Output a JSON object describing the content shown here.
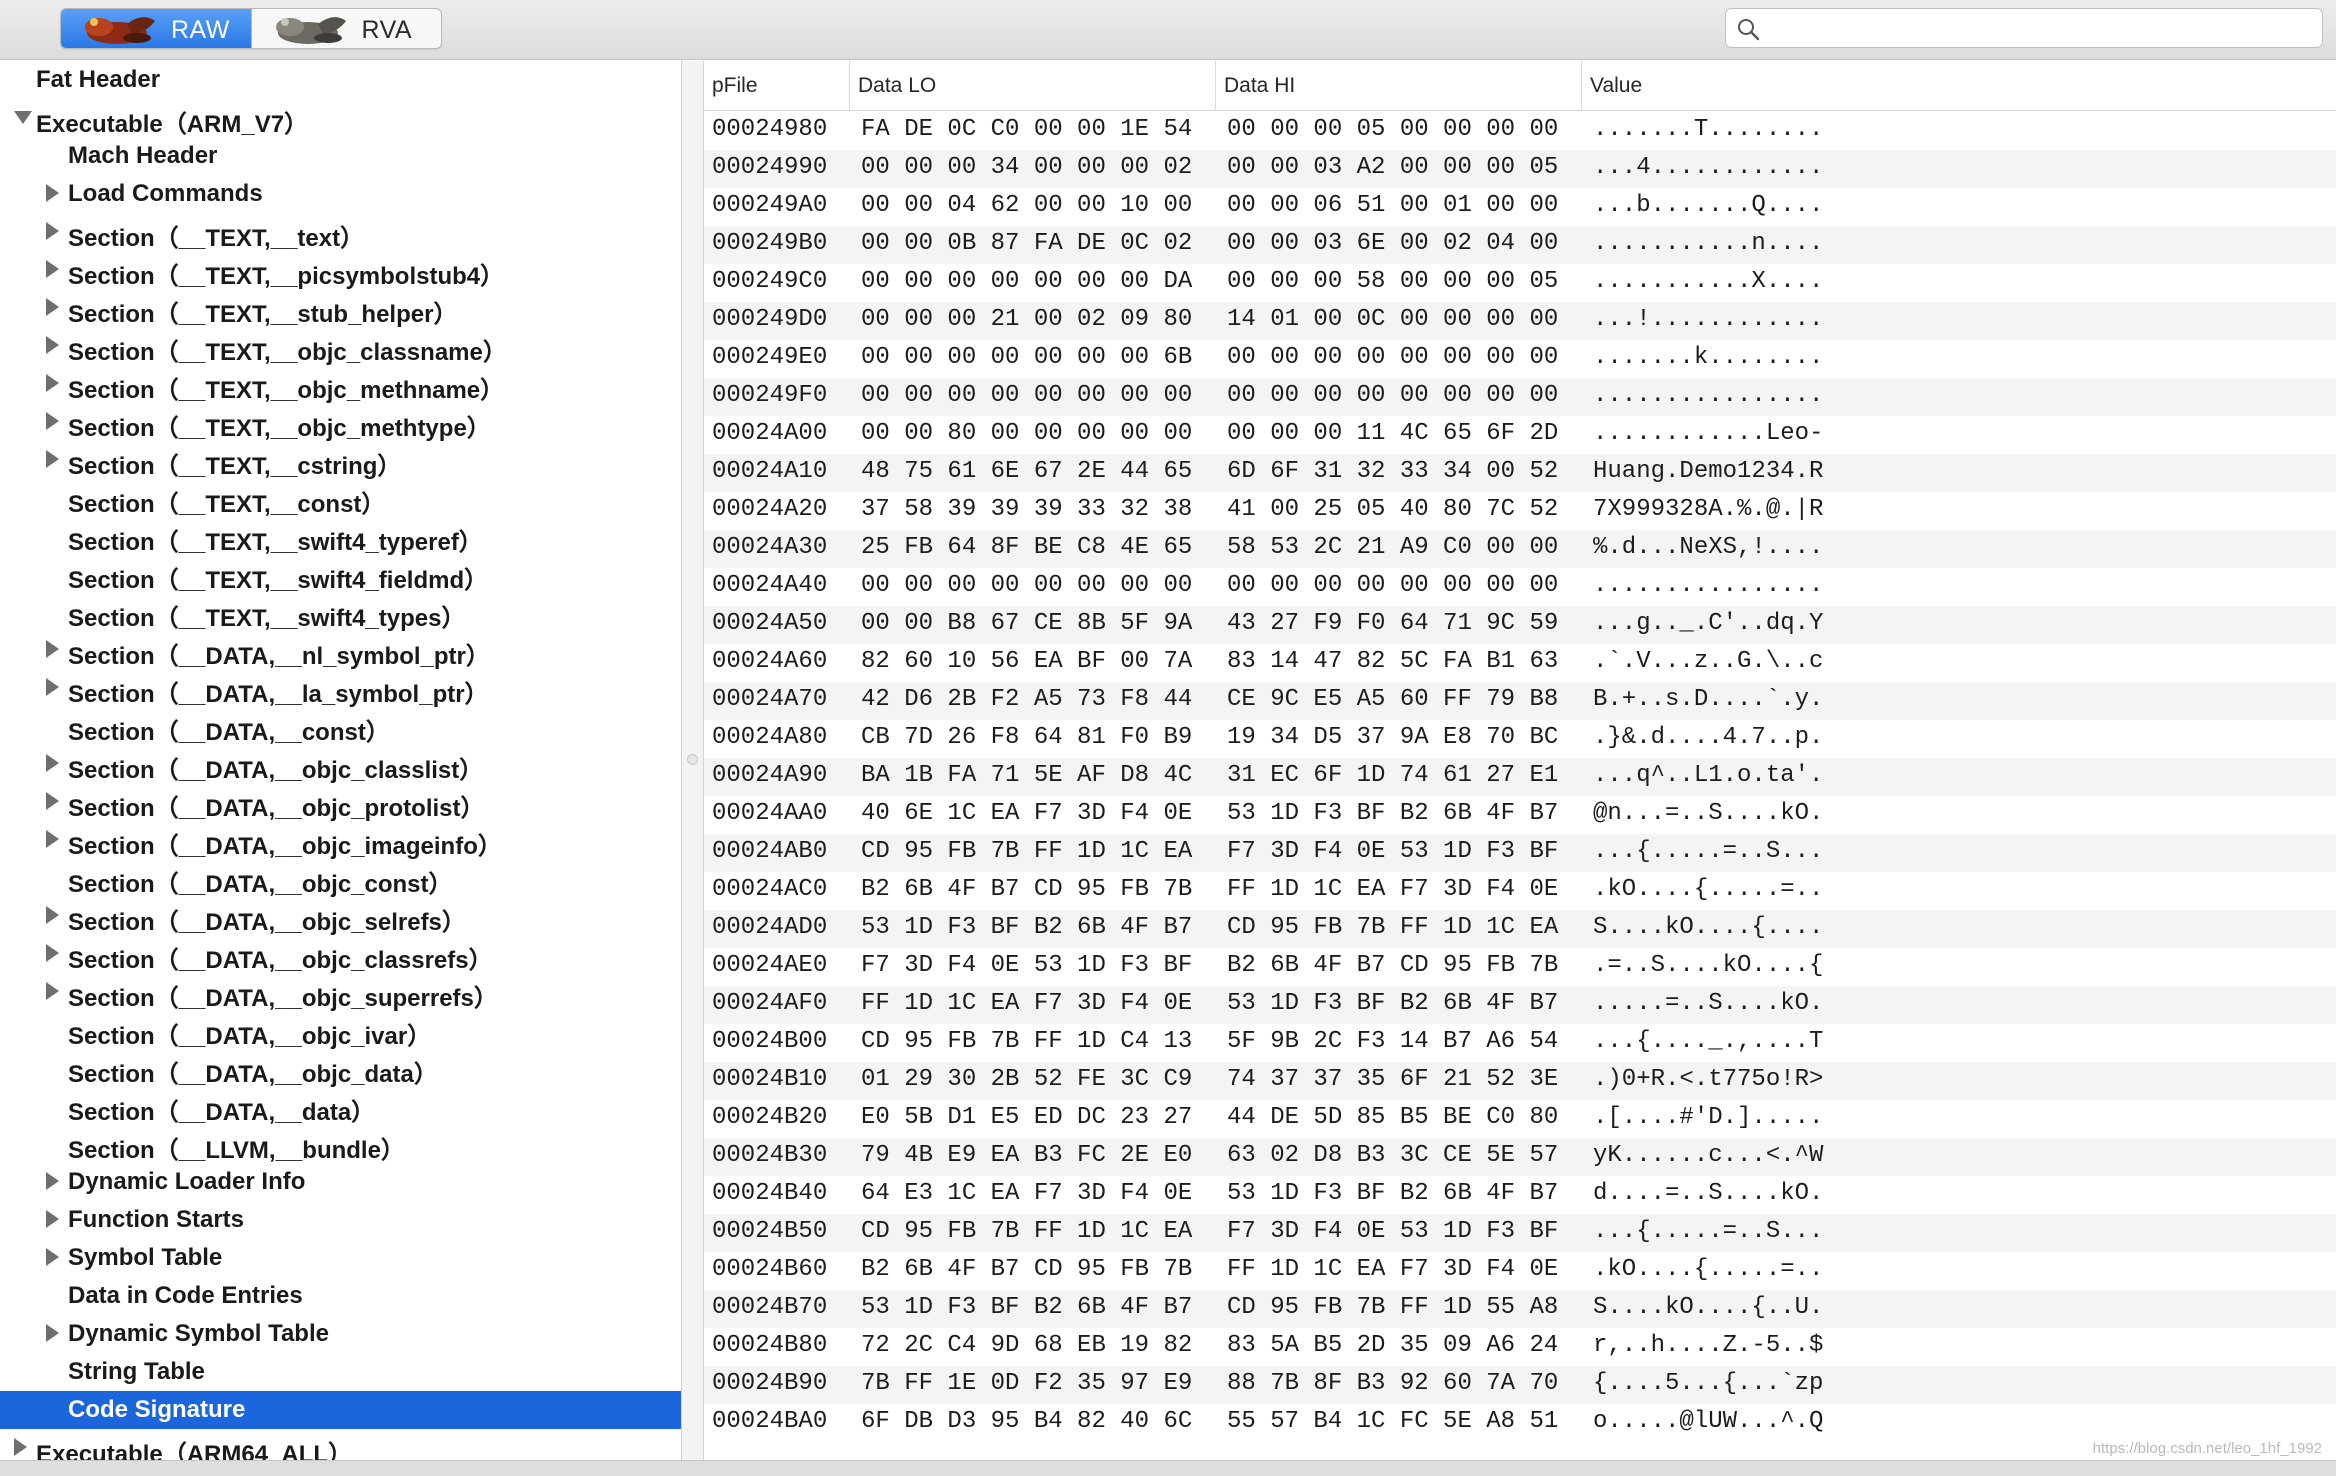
{
  "toolbar": {
    "segments": [
      {
        "label": "RAW",
        "icon": "red-frog-icon",
        "selected": true
      },
      {
        "label": "RVA",
        "icon": "grey-frog-icon",
        "selected": false
      }
    ],
    "search": {
      "placeholder": "",
      "value": ""
    }
  },
  "sidebar": {
    "items": [
      {
        "label": "Fat Header",
        "level": 0,
        "disclosure": "none",
        "selected": false
      },
      {
        "label": "Executable（ARM_V7）",
        "level": 0,
        "disclosure": "open",
        "selected": false
      },
      {
        "label": "Mach Header",
        "level": 1,
        "disclosure": "none",
        "selected": false
      },
      {
        "label": "Load Commands",
        "level": 1,
        "disclosure": "closed",
        "selected": false
      },
      {
        "label": "Section（__TEXT,__text）",
        "level": 1,
        "disclosure": "closed",
        "selected": false
      },
      {
        "label": "Section（__TEXT,__picsymbolstub4）",
        "level": 1,
        "disclosure": "closed",
        "selected": false
      },
      {
        "label": "Section（__TEXT,__stub_helper）",
        "level": 1,
        "disclosure": "closed",
        "selected": false
      },
      {
        "label": "Section（__TEXT,__objc_classname）",
        "level": 1,
        "disclosure": "closed",
        "selected": false
      },
      {
        "label": "Section（__TEXT,__objc_methname）",
        "level": 1,
        "disclosure": "closed",
        "selected": false
      },
      {
        "label": "Section（__TEXT,__objc_methtype）",
        "level": 1,
        "disclosure": "closed",
        "selected": false
      },
      {
        "label": "Section（__TEXT,__cstring）",
        "level": 1,
        "disclosure": "closed",
        "selected": false
      },
      {
        "label": "Section（__TEXT,__const）",
        "level": 1,
        "disclosure": "none",
        "selected": false
      },
      {
        "label": "Section（__TEXT,__swift4_typeref）",
        "level": 1,
        "disclosure": "none",
        "selected": false
      },
      {
        "label": "Section（__TEXT,__swift4_fieldmd）",
        "level": 1,
        "disclosure": "none",
        "selected": false
      },
      {
        "label": "Section（__TEXT,__swift4_types）",
        "level": 1,
        "disclosure": "none",
        "selected": false
      },
      {
        "label": "Section（__DATA,__nl_symbol_ptr）",
        "level": 1,
        "disclosure": "closed",
        "selected": false
      },
      {
        "label": "Section（__DATA,__la_symbol_ptr）",
        "level": 1,
        "disclosure": "closed",
        "selected": false
      },
      {
        "label": "Section（__DATA,__const）",
        "level": 1,
        "disclosure": "none",
        "selected": false
      },
      {
        "label": "Section（__DATA,__objc_classlist）",
        "level": 1,
        "disclosure": "closed",
        "selected": false
      },
      {
        "label": "Section（__DATA,__objc_protolist）",
        "level": 1,
        "disclosure": "closed",
        "selected": false
      },
      {
        "label": "Section（__DATA,__objc_imageinfo）",
        "level": 1,
        "disclosure": "closed",
        "selected": false
      },
      {
        "label": "Section（__DATA,__objc_const）",
        "level": 1,
        "disclosure": "none",
        "selected": false
      },
      {
        "label": "Section（__DATA,__objc_selrefs）",
        "level": 1,
        "disclosure": "closed",
        "selected": false
      },
      {
        "label": "Section（__DATA,__objc_classrefs）",
        "level": 1,
        "disclosure": "closed",
        "selected": false
      },
      {
        "label": "Section（__DATA,__objc_superrefs）",
        "level": 1,
        "disclosure": "closed",
        "selected": false
      },
      {
        "label": "Section（__DATA,__objc_ivar）",
        "level": 1,
        "disclosure": "none",
        "selected": false
      },
      {
        "label": "Section（__DATA,__objc_data）",
        "level": 1,
        "disclosure": "none",
        "selected": false
      },
      {
        "label": "Section（__DATA,__data）",
        "level": 1,
        "disclosure": "none",
        "selected": false
      },
      {
        "label": "Section（__LLVM,__bundle）",
        "level": 1,
        "disclosure": "none",
        "selected": false
      },
      {
        "label": "Dynamic Loader Info",
        "level": 1,
        "disclosure": "closed",
        "selected": false
      },
      {
        "label": "Function Starts",
        "level": 1,
        "disclosure": "closed",
        "selected": false
      },
      {
        "label": "Symbol Table",
        "level": 1,
        "disclosure": "closed",
        "selected": false
      },
      {
        "label": "Data in Code Entries",
        "level": 1,
        "disclosure": "none",
        "selected": false
      },
      {
        "label": "Dynamic Symbol Table",
        "level": 1,
        "disclosure": "closed",
        "selected": false
      },
      {
        "label": "String Table",
        "level": 1,
        "disclosure": "none",
        "selected": false
      },
      {
        "label": "Code Signature",
        "level": 1,
        "disclosure": "none",
        "selected": true
      },
      {
        "label": "Executable（ARM64_ALL）",
        "level": 0,
        "disclosure": "closed",
        "selected": false
      }
    ]
  },
  "table": {
    "columns": [
      "pFile",
      "Data LO",
      "Data HI",
      "Value"
    ],
    "rows": [
      [
        "00024980",
        "FA DE 0C C0 00 00 1E 54",
        "00 00 00 05 00 00 00 00",
        ".......T........"
      ],
      [
        "00024990",
        "00 00 00 34 00 00 00 02",
        "00 00 03 A2 00 00 00 05",
        "...4............"
      ],
      [
        "000249A0",
        "00 00 04 62 00 00 10 00",
        "00 00 06 51 00 01 00 00",
        "...b.......Q...."
      ],
      [
        "000249B0",
        "00 00 0B 87 FA DE 0C 02",
        "00 00 03 6E 00 02 04 00",
        "...........n...."
      ],
      [
        "000249C0",
        "00 00 00 00 00 00 00 DA",
        "00 00 00 58 00 00 00 05",
        "...........X...."
      ],
      [
        "000249D0",
        "00 00 00 21 00 02 09 80",
        "14 01 00 0C 00 00 00 00",
        "...!............"
      ],
      [
        "000249E0",
        "00 00 00 00 00 00 00 6B",
        "00 00 00 00 00 00 00 00",
        ".......k........"
      ],
      [
        "000249F0",
        "00 00 00 00 00 00 00 00",
        "00 00 00 00 00 00 00 00",
        "................"
      ],
      [
        "00024A00",
        "00 00 80 00 00 00 00 00",
        "00 00 00 11 4C 65 6F 2D",
        "............Leo-"
      ],
      [
        "00024A10",
        "48 75 61 6E 67 2E 44 65",
        "6D 6F 31 32 33 34 00 52",
        "Huang.Demo1234.R"
      ],
      [
        "00024A20",
        "37 58 39 39 39 33 32 38",
        "41 00 25 05 40 80 7C 52",
        "7X999328A.%.@.|R"
      ],
      [
        "00024A30",
        "25 FB 64 8F BE C8 4E 65",
        "58 53 2C 21 A9 C0 00 00",
        "%.d...NeXS,!...."
      ],
      [
        "00024A40",
        "00 00 00 00 00 00 00 00",
        "00 00 00 00 00 00 00 00",
        "................"
      ],
      [
        "00024A50",
        "00 00 B8 67 CE 8B 5F 9A",
        "43 27 F9 F0 64 71 9C 59",
        "...g.._.C'..dq.Y"
      ],
      [
        "00024A60",
        "82 60 10 56 EA BF 00 7A",
        "83 14 47 82 5C FA B1 63",
        ".`.V...z..G.\\..c"
      ],
      [
        "00024A70",
        "42 D6 2B F2 A5 73 F8 44",
        "CE 9C E5 A5 60 FF 79 B8",
        "B.+..s.D....`.y."
      ],
      [
        "00024A80",
        "CB 7D 26 F8 64 81 F0 B9",
        "19 34 D5 37 9A E8 70 BC",
        ".}&.d....4.7..p."
      ],
      [
        "00024A90",
        "BA 1B FA 71 5E AF D8 4C",
        "31 EC 6F 1D 74 61 27 E1",
        "...q^..L1.o.ta'."
      ],
      [
        "00024AA0",
        "40 6E 1C EA F7 3D F4 0E",
        "53 1D F3 BF B2 6B 4F B7",
        "@n...=..S....kO."
      ],
      [
        "00024AB0",
        "CD 95 FB 7B FF 1D 1C EA",
        "F7 3D F4 0E 53 1D F3 BF",
        "...{.....=..S..."
      ],
      [
        "00024AC0",
        "B2 6B 4F B7 CD 95 FB 7B",
        "FF 1D 1C EA F7 3D F4 0E",
        ".kO....{.....=.."
      ],
      [
        "00024AD0",
        "53 1D F3 BF B2 6B 4F B7",
        "CD 95 FB 7B FF 1D 1C EA",
        "S....kO....{...."
      ],
      [
        "00024AE0",
        "F7 3D F4 0E 53 1D F3 BF",
        "B2 6B 4F B7 CD 95 FB 7B",
        ".=..S....kO....{"
      ],
      [
        "00024AF0",
        "FF 1D 1C EA F7 3D F4 0E",
        "53 1D F3 BF B2 6B 4F B7",
        ".....=..S....kO."
      ],
      [
        "00024B00",
        "CD 95 FB 7B FF 1D C4 13",
        "5F 9B 2C F3 14 B7 A6 54",
        "...{...._.,....T"
      ],
      [
        "00024B10",
        "01 29 30 2B 52 FE 3C C9",
        "74 37 37 35 6F 21 52 3E",
        ".)0+R.<.t775o!R>"
      ],
      [
        "00024B20",
        "E0 5B D1 E5 ED DC 23 27",
        "44 DE 5D 85 B5 BE C0 80",
        ".[....#'D.]....."
      ],
      [
        "00024B30",
        "79 4B E9 EA B3 FC 2E E0",
        "63 02 D8 B3 3C CE 5E 57",
        "yK......c...<.^W"
      ],
      [
        "00024B40",
        "64 E3 1C EA F7 3D F4 0E",
        "53 1D F3 BF B2 6B 4F B7",
        "d....=..S....kO."
      ],
      [
        "00024B50",
        "CD 95 FB 7B FF 1D 1C EA",
        "F7 3D F4 0E 53 1D F3 BF",
        "...{.....=..S..."
      ],
      [
        "00024B60",
        "B2 6B 4F B7 CD 95 FB 7B",
        "FF 1D 1C EA F7 3D F4 0E",
        ".kO....{.....=.."
      ],
      [
        "00024B70",
        "53 1D F3 BF B2 6B 4F B7",
        "CD 95 FB 7B FF 1D 55 A8",
        "S....kO....{..U."
      ],
      [
        "00024B80",
        "72 2C C4 9D 68 EB 19 82",
        "83 5A B5 2D 35 09 A6 24",
        "r,..h....Z.-5..$"
      ],
      [
        "00024B90",
        "7B FF 1E 0D F2 35 97 E9",
        "88 7B 8F B3 92 60 7A 70",
        "{....5...{...`zp"
      ],
      [
        "00024BA0",
        "6F DB D3 95 B4 82 40 6C",
        "55 57 B4 1C FC 5E A8 51",
        "o.....@lUW...^.Q"
      ]
    ]
  },
  "watermark": "https://blog.csdn.net/leo_1hf_1992",
  "colors": {
    "accent": "#1b66dd",
    "toolbar_bg": "#e3e3e3",
    "stripe": "#f4f4f4"
  }
}
